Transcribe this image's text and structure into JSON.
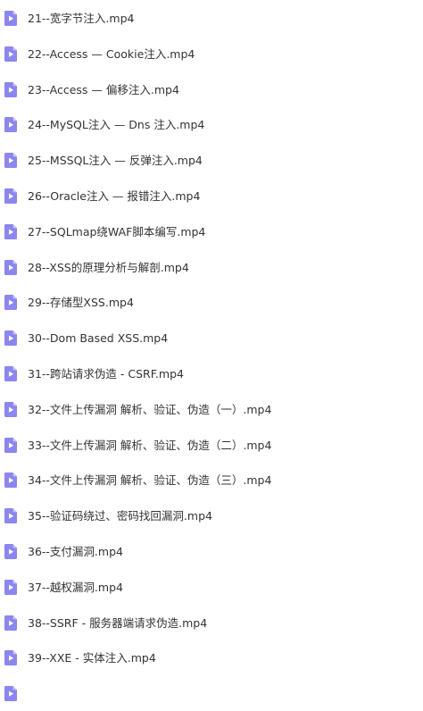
{
  "files": [
    {
      "name": "21--宽字节注入.mp4",
      "icon": "video-file-icon"
    },
    {
      "name": "22--Access — Cookie注入.mp4",
      "icon": "video-file-icon"
    },
    {
      "name": "23--Access — 偏移注入.mp4",
      "icon": "video-file-icon"
    },
    {
      "name": "24--MySQL注入 — Dns 注入.mp4",
      "icon": "video-file-icon"
    },
    {
      "name": "25--MSSQL注入 — 反弹注入.mp4",
      "icon": "video-file-icon"
    },
    {
      "name": "26--Oracle注入 — 报错注入.mp4",
      "icon": "video-file-icon"
    },
    {
      "name": "27--SQLmap绕WAF脚本编写.mp4",
      "icon": "video-file-icon"
    },
    {
      "name": "28--XSS的原理分析与解剖.mp4",
      "icon": "video-file-icon"
    },
    {
      "name": "29--存储型XSS.mp4",
      "icon": "video-file-icon"
    },
    {
      "name": "30--Dom Based XSS.mp4",
      "icon": "video-file-icon"
    },
    {
      "name": "31--跨站请求伪造 - CSRF.mp4",
      "icon": "video-file-icon"
    },
    {
      "name": "32--文件上传漏洞 解析、验证、伪造（一）.mp4",
      "icon": "video-file-icon"
    },
    {
      "name": "33--文件上传漏洞 解析、验证、伪造（二）.mp4",
      "icon": "video-file-icon"
    },
    {
      "name": "34--文件上传漏洞 解析、验证、伪造（三）.mp4",
      "icon": "video-file-icon"
    },
    {
      "name": "35--验证码绕过、密码找回漏洞.mp4",
      "icon": "video-file-icon"
    },
    {
      "name": "36--支付漏洞.mp4",
      "icon": "video-file-icon"
    },
    {
      "name": "37--越权漏洞.mp4",
      "icon": "video-file-icon"
    },
    {
      "name": "38--SSRF - 服务器端请求伪造.mp4",
      "icon": "video-file-icon"
    },
    {
      "name": "39--XXE - 实体注入.mp4",
      "icon": "video-file-icon"
    }
  ],
  "colors": {
    "icon_purple": "#8c86ef",
    "icon_fold": "#c7c3f8",
    "text": "#333333"
  }
}
